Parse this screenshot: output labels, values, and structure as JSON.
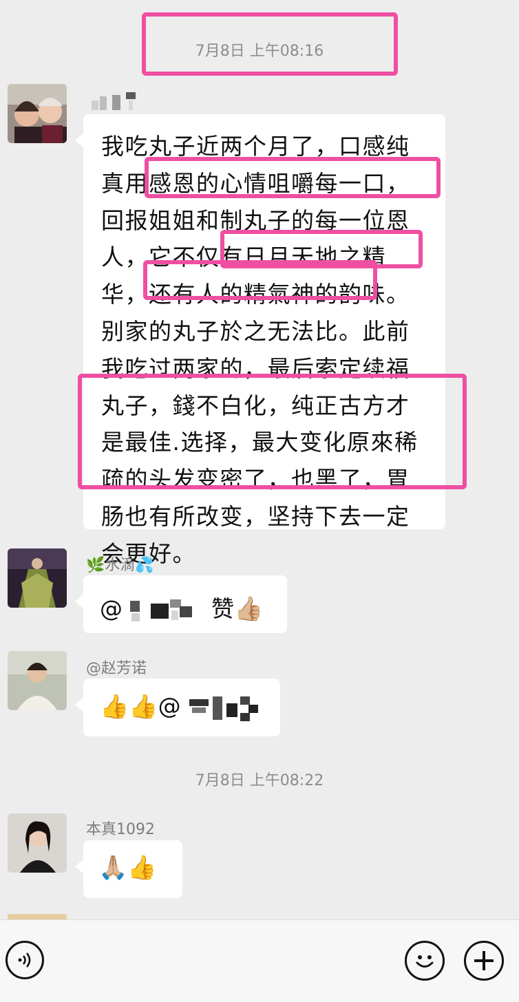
{
  "timestamps": [
    "7月8日 上午08:16",
    "7月8日 上午08:22"
  ],
  "messages": [
    {
      "sender": "",
      "text": "我吃丸子近两个月了，口感纯真用感恩的心情咀嚼每一口，回报姐姐和制丸子的每一位恩人，它不仅有日月天地之精华，还有人的精氣神的韵味。别家的丸子於之无法比。此前我吃过两家的，最后索定续福丸子，錢不白化，纯正古方才是最佳.选择，最大变化原來稀疏的头发变密了，也黑了，胃肠也有所改变，坚持下去一定会更好。"
    },
    {
      "sender": "🌿水滴💦",
      "text_prefix": "@",
      "text_suffix": "赞",
      "emoji": "👍🏼"
    },
    {
      "sender": "@赵芳诺",
      "emojis": "👍👍",
      "text_prefix": "@"
    },
    {
      "sender": "本真1092",
      "emojis": "🙏🏼👍"
    }
  ],
  "icons": {
    "voice": "voice-icon",
    "emoji": "smiley-icon",
    "plus": "plus-icon"
  },
  "colors": {
    "highlight": "#ee4fa3",
    "background": "#ededed",
    "bubble": "#ffffff"
  }
}
